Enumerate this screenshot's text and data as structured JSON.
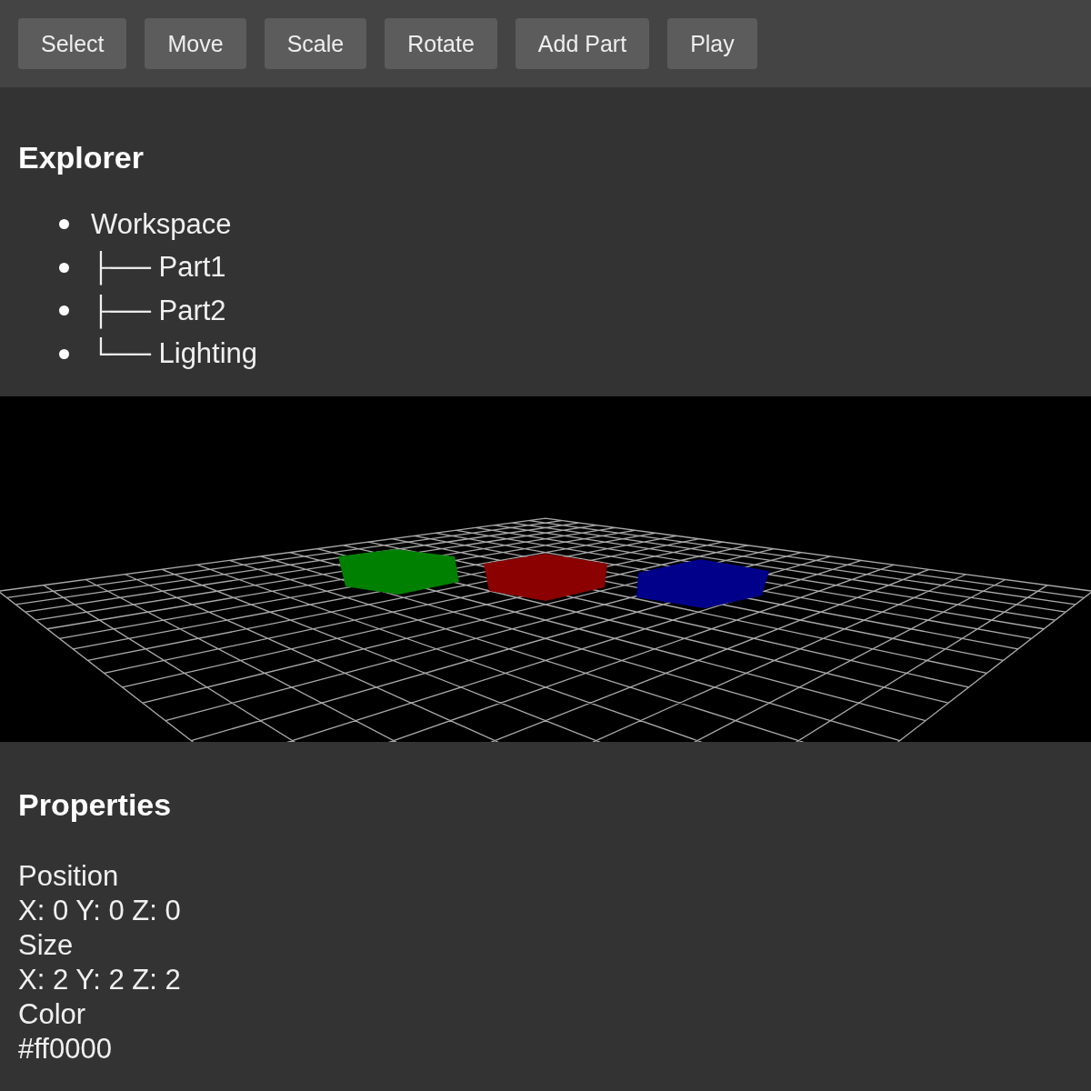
{
  "toolbar": {
    "buttons": [
      "Select",
      "Move",
      "Scale",
      "Rotate",
      "Add Part",
      "Play"
    ]
  },
  "explorer": {
    "title": "Explorer",
    "items": [
      {
        "label": "Workspace"
      },
      {
        "label": "├── Part1"
      },
      {
        "label": "├── Part2"
      },
      {
        "label": "└── Lighting"
      }
    ]
  },
  "viewport": {
    "parts": [
      {
        "color": "#008000"
      },
      {
        "color": "#8b0000"
      },
      {
        "color": "#00008b"
      }
    ]
  },
  "properties": {
    "title": "Properties",
    "fields": [
      {
        "label": "Position",
        "value": "X: 0 Y: 0 Z: 0"
      },
      {
        "label": "Size",
        "value": "X: 2 Y: 2 Z: 2"
      },
      {
        "label": "Color",
        "value": "#ff0000"
      }
    ]
  }
}
